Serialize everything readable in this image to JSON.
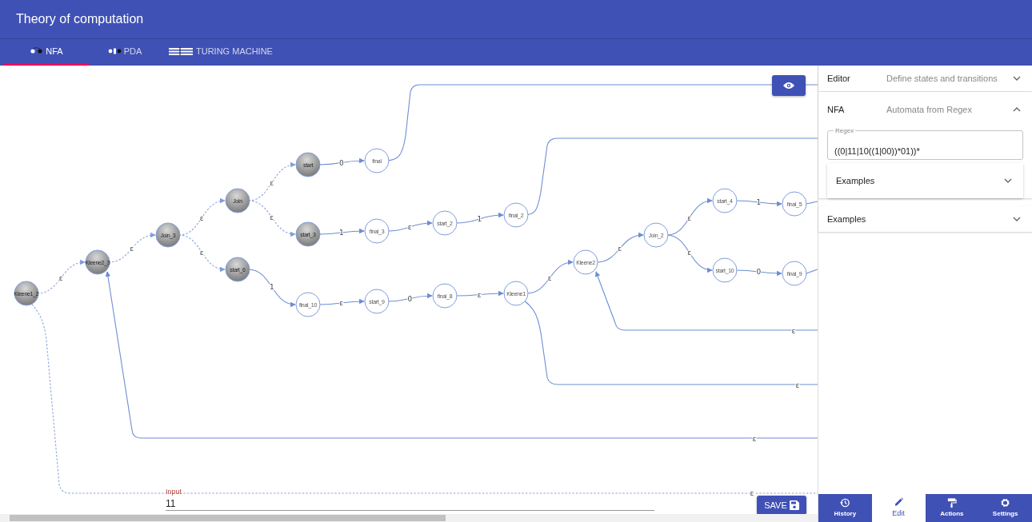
{
  "app": {
    "title": "Theory of computation"
  },
  "tabs": [
    {
      "label": "NFA",
      "kind": "nfa",
      "selected": true
    },
    {
      "label": "PDA",
      "kind": "pda",
      "selected": false
    },
    {
      "label": "TURING MACHINE",
      "kind": "turing",
      "selected": false
    }
  ],
  "graph": {
    "states": [
      {
        "name": "Kleene1_2",
        "active": true
      },
      {
        "name": "Kleene2_3",
        "active": true
      },
      {
        "name": "Join_3",
        "active": true
      },
      {
        "name": "Join",
        "active": true
      },
      {
        "name": "start",
        "active": true
      },
      {
        "name": "start_3",
        "active": true
      },
      {
        "name": "start_6",
        "active": true
      },
      {
        "name": "final",
        "active": false
      },
      {
        "name": "final_3",
        "active": false
      },
      {
        "name": "start_2",
        "active": false
      },
      {
        "name": "final_2",
        "active": false
      },
      {
        "name": "final_10",
        "active": false
      },
      {
        "name": "start_9",
        "active": false
      },
      {
        "name": "final_8",
        "active": false
      },
      {
        "name": "Kleene1",
        "active": false
      },
      {
        "name": "Kleene2",
        "active": false
      },
      {
        "name": "Join_2",
        "active": false
      },
      {
        "name": "start_4",
        "active": false
      },
      {
        "name": "final_5",
        "active": false
      },
      {
        "name": "start_10",
        "active": false
      },
      {
        "name": "final_9",
        "active": false
      }
    ],
    "transitions": [
      {
        "label": "ε",
        "dashed": true
      },
      {
        "label": "ε",
        "dashed": true
      },
      {
        "label": "ε",
        "dashed": true
      },
      {
        "label": "ε",
        "dashed": true
      },
      {
        "label": "ε",
        "dashed": true
      },
      {
        "label": "ε",
        "dashed": true
      },
      {
        "label": "0",
        "dashed": false
      },
      {
        "label": "1",
        "dashed": false
      },
      {
        "label": "ε",
        "dashed": false
      },
      {
        "label": "1",
        "dashed": false
      },
      {
        "label": "1",
        "dashed": false
      },
      {
        "label": "ε",
        "dashed": false
      },
      {
        "label": "0",
        "dashed": false
      },
      {
        "label": "ε",
        "dashed": false
      },
      {
        "label": "ε",
        "dashed": false
      },
      {
        "label": "ε",
        "dashed": false
      },
      {
        "label": "ε",
        "dashed": false
      },
      {
        "label": "ε",
        "dashed": false
      },
      {
        "label": "1",
        "dashed": false
      },
      {
        "label": "0",
        "dashed": false
      },
      {
        "dashed": false
      },
      {
        "dashed": false
      },
      {
        "dashed": false
      },
      {
        "dashed": false
      },
      {
        "label": "ε",
        "dashed": false
      },
      {
        "label": "ε",
        "dashed": false
      },
      {
        "label": "ε",
        "dashed": false
      },
      {
        "label": "ε",
        "dashed": true
      }
    ]
  },
  "input": {
    "label": "Input",
    "value": "11"
  },
  "save_button": {
    "label": "SAVE"
  },
  "panel": {
    "sections": [
      {
        "title": "Editor",
        "subtitle": "Define states and transitions",
        "expanded": false
      },
      {
        "title": "NFA",
        "subtitle": "Automata from Regex",
        "expanded": true,
        "regex": {
          "label": "Regex",
          "value": "((0|11|10((1|00))*01))*"
        },
        "subsections": [
          {
            "title": "Examples",
            "expanded": false
          }
        ]
      },
      {
        "title": "Examples",
        "expanded": false
      }
    ]
  },
  "bottom_nav": [
    {
      "label": "History",
      "kind": "history",
      "selected": false
    },
    {
      "label": "Edit",
      "kind": "edit",
      "selected": true
    },
    {
      "label": "Actions",
      "kind": "actions",
      "selected": false
    },
    {
      "label": "Settings",
      "kind": "settings",
      "selected": false
    }
  ]
}
